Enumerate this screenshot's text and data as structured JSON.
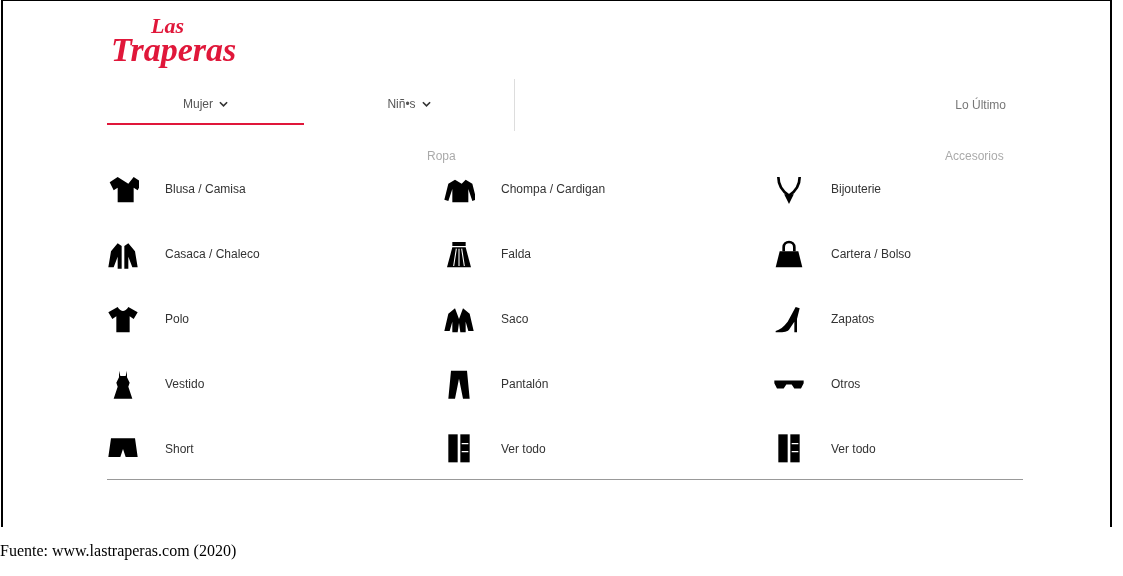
{
  "logo": {
    "line_1": "Las",
    "line_2": "Traperas"
  },
  "nav": {
    "tabs": [
      {
        "label": "Mujer",
        "selected": true
      },
      {
        "label": "Niñ•s",
        "selected": false
      }
    ],
    "latest": "Lo Último"
  },
  "headings": [
    "Ropa",
    "Accesorios"
  ],
  "grid": [
    {
      "label": "Blusa / Camisa",
      "kind": "blouse"
    },
    {
      "label": "Chompa / Cardigan",
      "kind": "sweater"
    },
    {
      "label": "Bijouterie",
      "kind": "necklace"
    },
    {
      "label": "Casaca / Chaleco",
      "kind": "jacket"
    },
    {
      "label": "Falda",
      "kind": "skirt"
    },
    {
      "label": "Cartera / Bolso",
      "kind": "handbag"
    },
    {
      "label": "Polo",
      "kind": "tshirt"
    },
    {
      "label": "Saco",
      "kind": "blazer"
    },
    {
      "label": "Zapatos",
      "kind": "heel"
    },
    {
      "label": "Vestido",
      "kind": "dress"
    },
    {
      "label": "Pantalón",
      "kind": "pants"
    },
    {
      "label": "Otros",
      "kind": "glasses"
    },
    {
      "label": "Short",
      "kind": "shorts"
    },
    {
      "label": "Ver todo",
      "kind": "wardrobe"
    },
    {
      "label": "Ver todo",
      "kind": "wardrobe"
    }
  ],
  "caption": "Fuente: www.lastraperas.com (2020)"
}
